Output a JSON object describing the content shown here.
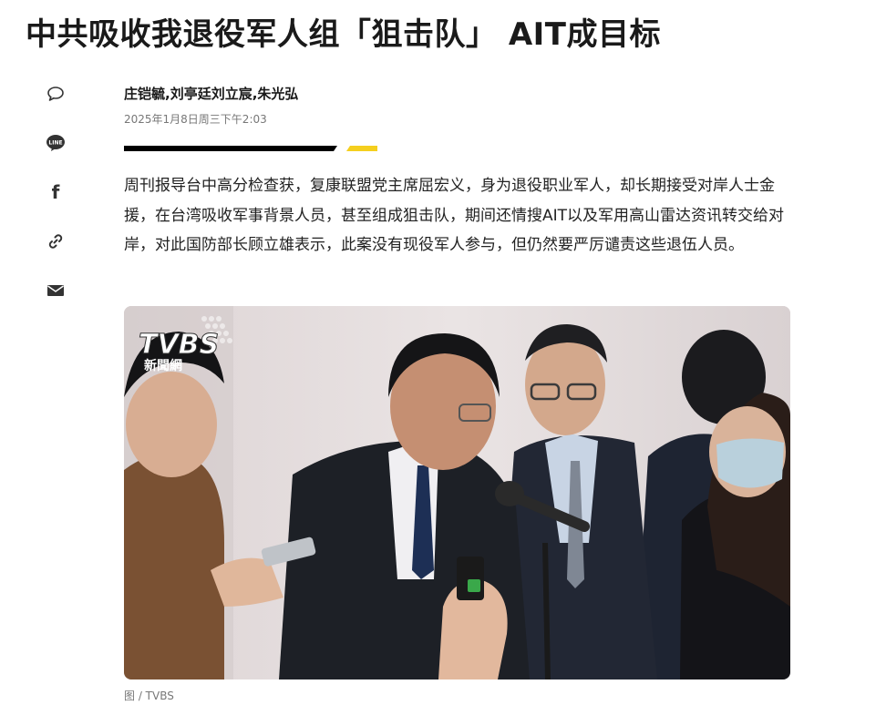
{
  "article": {
    "headline": "中共吸收我退役军人组「狙击队」 AIT成目标",
    "authors": "庄铠毓,刘亭廷刘立宸,朱光弘",
    "datetime": "2025年1月8日周三下午2:03",
    "lead": "周刊报导台中高分检查获，复康联盟党主席屈宏义，身为退役职业军人，却长期接受对岸人士金援，在台湾吸收军事背景人员，甚至组成狙击队，期间还情搜AIT以及军用高山雷达资讯转交给对岸，对此国防部长顾立雄表示，此案没有现役军人参与，但仍然要严厉谴责这些退伍人员。",
    "caption": "图 / TVBS"
  },
  "photo": {
    "logo_text": "TVBS",
    "logo_subtext": "新聞網"
  },
  "share": [
    {
      "icon": "comment-icon"
    },
    {
      "icon": "line-icon",
      "label": "LINE"
    },
    {
      "icon": "facebook-icon",
      "label": "f"
    },
    {
      "icon": "link-icon"
    },
    {
      "icon": "mail-icon"
    }
  ],
  "colors": {
    "accent_yellow": "#f5cf1e",
    "text": "#1a1a1a",
    "muted": "#777777"
  }
}
